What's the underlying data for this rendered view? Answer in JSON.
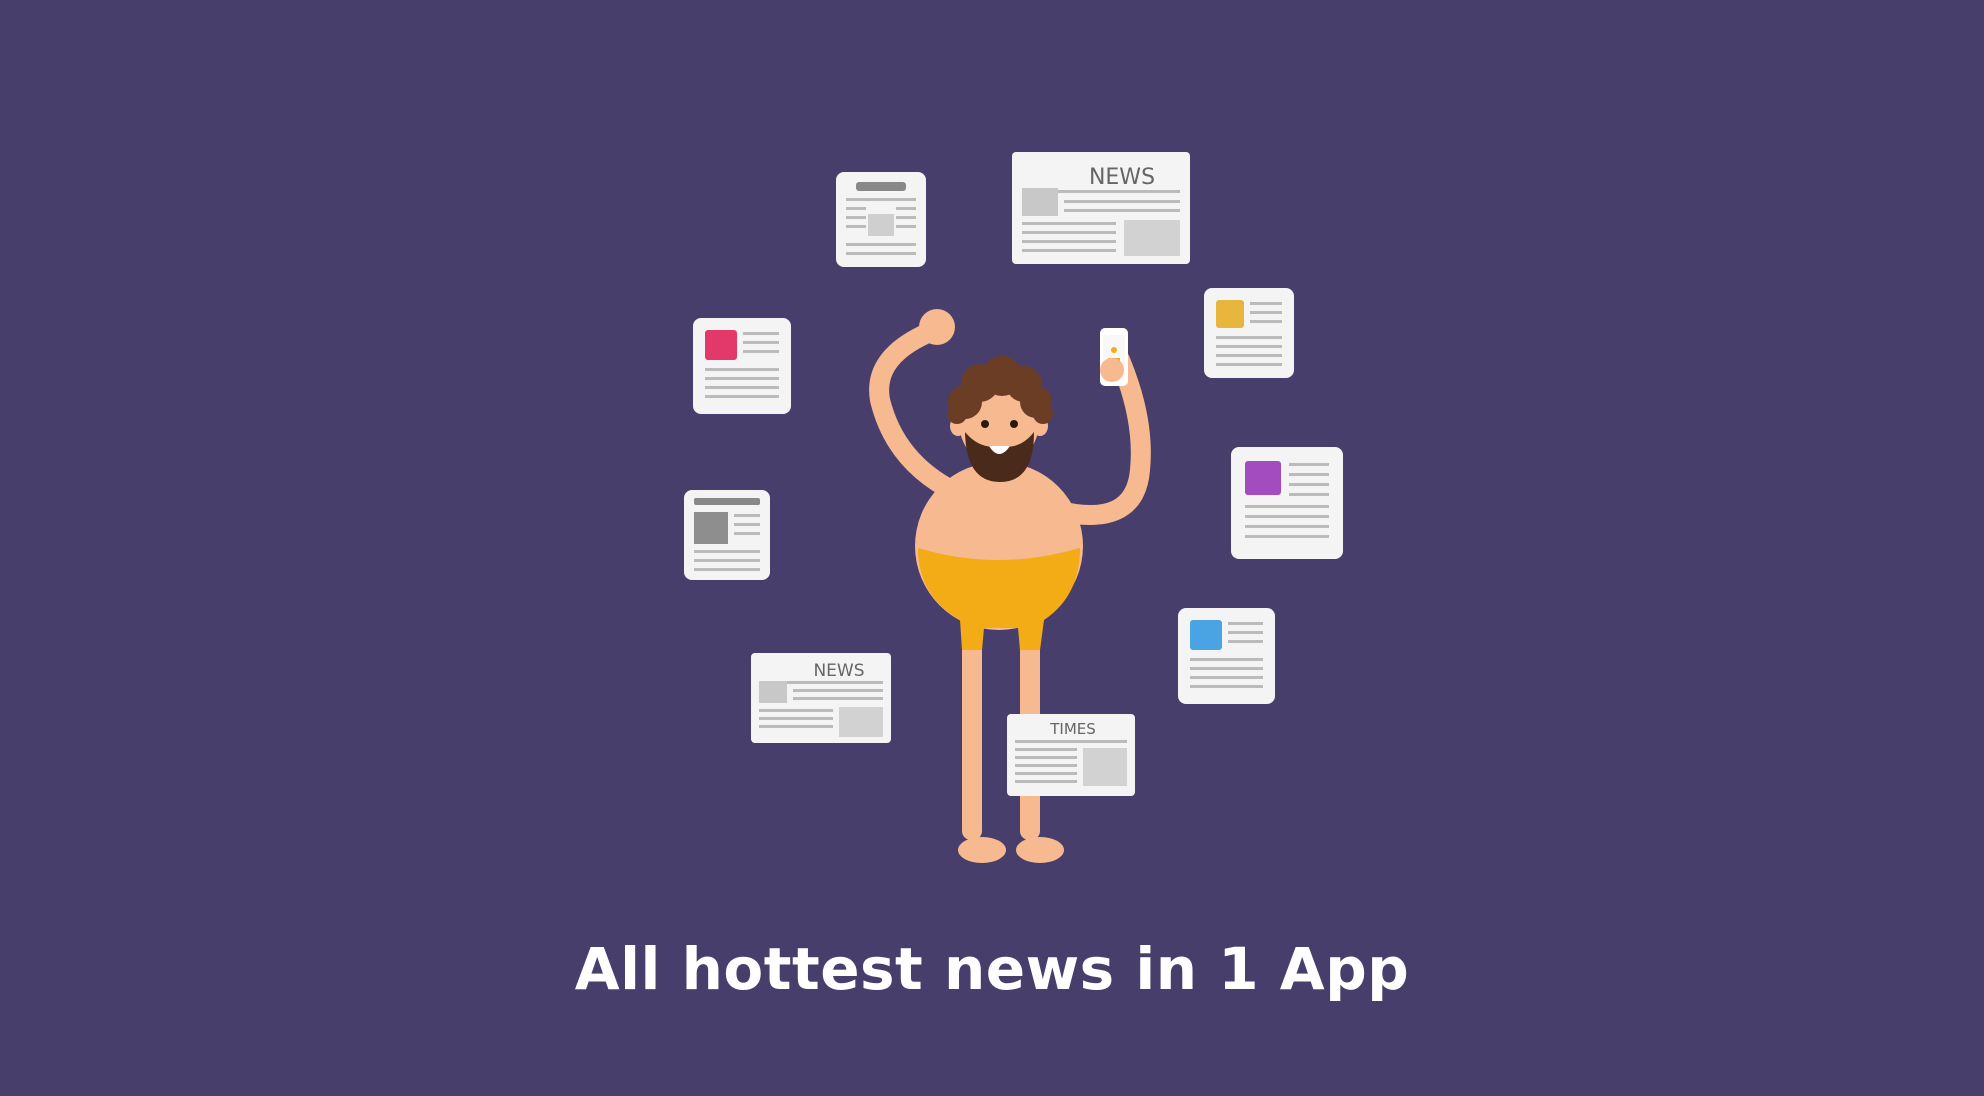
{
  "scene": {
    "caption": "All hottest news in 1 App",
    "masthead_news": "NEWS",
    "masthead_times": "TIMES"
  },
  "colors": {
    "background": "#473e6c",
    "paper": "#f4f4f4",
    "paper_line": "#b9b9b9",
    "skin": "#f7b98f",
    "hair": "#6b3d25",
    "beard": "#4a2a1a",
    "shorts": "#f3ab16",
    "accent_pink": "#e2396a",
    "accent_yellow": "#e8b63c",
    "accent_purple": "#a24cc0",
    "accent_blue": "#4aa3e3"
  },
  "icons": [
    "newspaper-icon",
    "article-card-icon",
    "smartphone-icon"
  ]
}
